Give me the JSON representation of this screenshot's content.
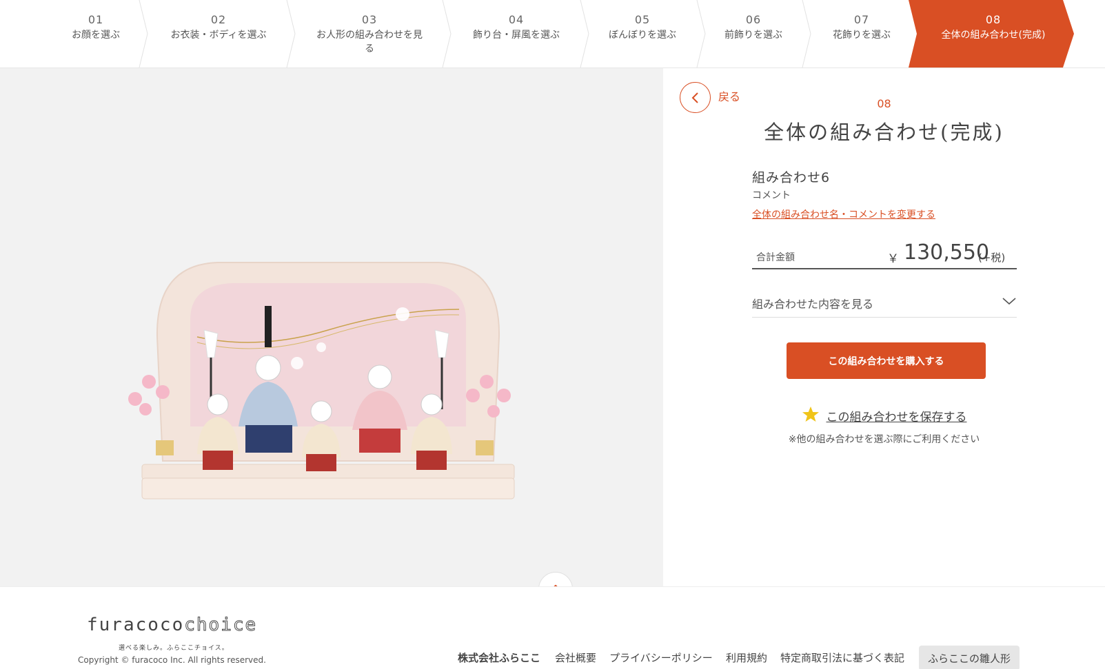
{
  "steps": [
    {
      "num": "01",
      "label": "お顔を選ぶ"
    },
    {
      "num": "02",
      "label": "お衣装・ボディを選ぶ"
    },
    {
      "num": "03",
      "label": "お人形の組み合わせを見る"
    },
    {
      "num": "04",
      "label": "飾り台・屏風を選ぶ"
    },
    {
      "num": "05",
      "label": "ぼんぼりを選ぶ"
    },
    {
      "num": "06",
      "label": "前飾りを選ぶ"
    },
    {
      "num": "07",
      "label": "花飾りを選ぶ"
    },
    {
      "num": "08",
      "label": "全体の組み合わせ(完成)"
    }
  ],
  "active_step": "08",
  "accent_color": "#d94f24",
  "detail": {
    "back_label": "戻る",
    "step_no": "08",
    "title": "全体の組み合わせ(完成)",
    "combo_name": "組み合わせ6",
    "comment_label": "コメント",
    "change_link": "全体の組み合わせ名・コメントを変更する",
    "total_label": "合計金額",
    "currency": "￥",
    "total_amount": "130,550",
    "tax_note": "(+税)",
    "contents_label": "組み合わせた内容を見る",
    "buy_button": "この組み合わせを購入する",
    "save_label": "この組み合わせを保存する",
    "save_note": "※他の組み合わせを選ぶ際にご利用ください"
  },
  "icons": {
    "back": "chevron-left-icon",
    "expand": "chevron-down-icon",
    "save": "star-icon",
    "scroll_top": "chevron-up-icon"
  },
  "footer": {
    "logo_main": "furacoco",
    "logo_sub": "choice",
    "tagline": "選べる楽しみ。ふらここチョイス。",
    "copyright": "Copyright © furacoco Inc. All rights reserved.",
    "links": [
      "株式会社ふらここ",
      "会社概要",
      "プライバシーポリシー",
      "利用規約",
      "特定商取引法に基づく表記"
    ],
    "button": "ふらここの雛人形"
  }
}
